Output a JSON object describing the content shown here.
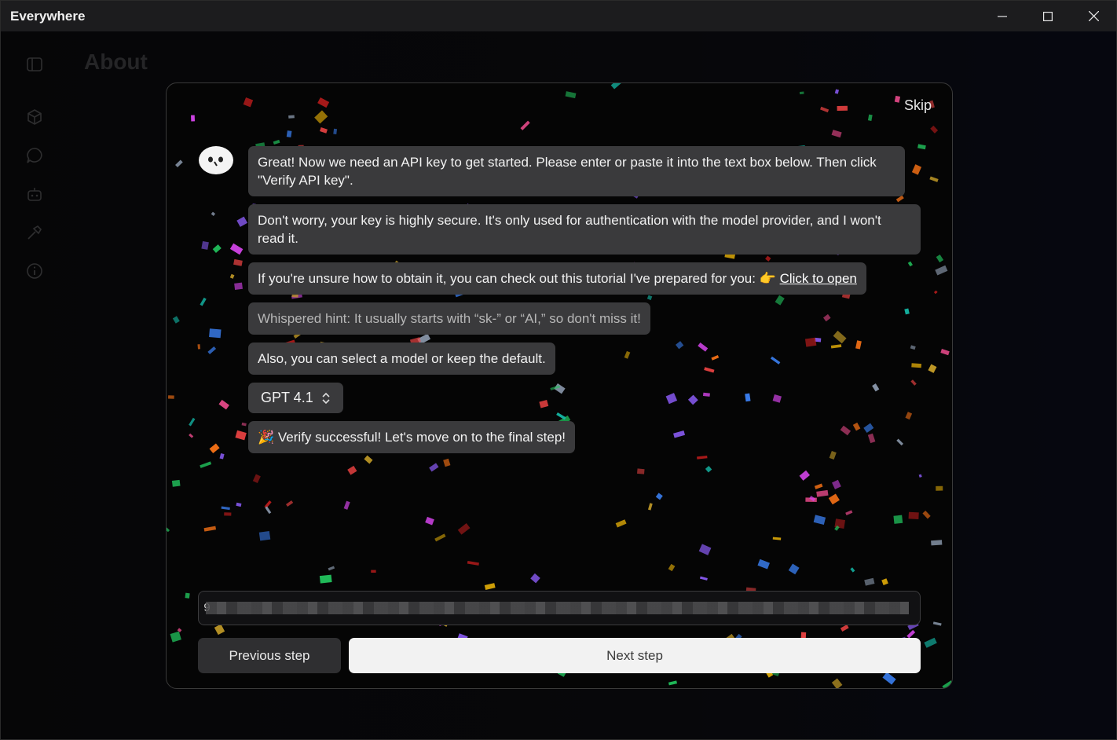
{
  "window": {
    "title": "Everywhere"
  },
  "page": {
    "heading": "About"
  },
  "sidebar": {
    "icons": [
      "sidebar-toggle-icon",
      "cube-icon",
      "chat-icon",
      "robot-icon",
      "hammer-icon",
      "info-icon"
    ]
  },
  "dialog": {
    "skip_label": "Skip",
    "messages": {
      "m1": "Great! Now we need an API key to get started. Please enter or paste it into the text box below. Then click \"Verify API key\".",
      "m2": "Don't worry, your key is highly secure. It's only used for authentication with the model provider, and I won't read it.",
      "m3_prefix": "If you're unsure how to obtain it, you can check out this tutorial I've prepared for you: ",
      "m3_emoji": "👉",
      "m3_link": "Click to open",
      "hint": "Whispered hint: It usually starts with “sk-” or “AI,” so don't miss it!",
      "m4": "Also, you can select a model or keep the default.",
      "success_emoji": "🎉",
      "success": "Verify successful! Let's move on to the final step!"
    },
    "model": {
      "selected": "GPT 4.1"
    },
    "api_key_prefix": "9",
    "buttons": {
      "previous": "Previous step",
      "next": "Next step"
    }
  },
  "colors": {
    "bubble": "#3a3a3c",
    "next_button": "#f2f2f2",
    "dialog_bg": "#050505"
  }
}
